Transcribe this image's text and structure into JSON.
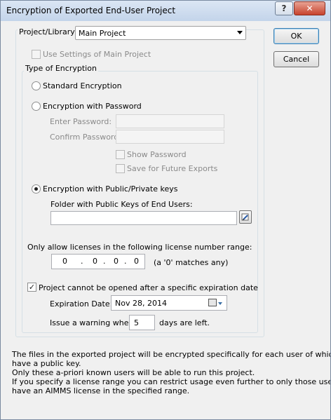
{
  "window": {
    "title": "Encryption of Exported End-User Project",
    "help_label": "?",
    "close_label": "✕"
  },
  "buttons": {
    "ok": "OK",
    "cancel": "Cancel"
  },
  "project": {
    "label": "Project/Library:",
    "selected": "Main Project",
    "use_settings_label": "Use Settings of Main Project",
    "use_settings_checked": false
  },
  "encryption": {
    "group_label": "Type of Encryption",
    "standard_label": "Standard Encryption",
    "password_label": "Encryption with Password",
    "enter_password_label": "Enter Password:",
    "confirm_password_label": "Confirm Password:",
    "enter_password_value": "",
    "confirm_password_value": "",
    "show_password_label": "Show Password",
    "save_future_label": "Save for Future Exports",
    "public_private_label": "Encryption with Public/Private keys",
    "selected": "public_private",
    "folder_label": "Folder with Public Keys of End Users:",
    "folder_value": ""
  },
  "license": {
    "range_label": "Only allow licenses in the following license number range:",
    "segments": [
      "0",
      "0",
      "0",
      "0"
    ],
    "separator": ".",
    "hint": "(a '0' matches any)"
  },
  "expiration": {
    "checkbox_label": "Project cannot be opened after a specific expiration date",
    "checked": true,
    "date_label": "Expiration Date:",
    "date_value": "Nov 28, 2014",
    "warning_label": "Issue a warning when",
    "warning_days": "5",
    "warning_suffix": "days are left."
  },
  "info_text": {
    "line1": "The files in the exported project will be encrypted specifically for each user of which you",
    "line2": "have a public key.",
    "line3": "Only these a-priori known users will be able to run this project.",
    "line4": "If you specify a license range you can restrict usage even further to only those users who",
    "line5": "have an AIMMS license in the specified range."
  },
  "colors": {
    "titlebar_top": "#dbe6f4",
    "titlebar_bottom": "#c3d4ea",
    "close_button": "#c7432d",
    "dialog_bg": "#f0f0f0"
  }
}
